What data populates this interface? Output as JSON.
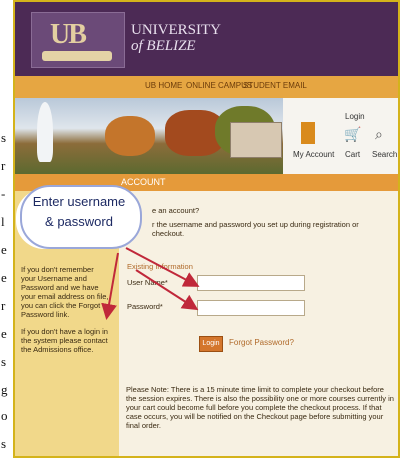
{
  "left_strip_letters": [
    "s",
    "r",
    "-",
    "l",
    "e",
    "e",
    "r",
    "e",
    "s",
    "g",
    "o",
    "s"
  ],
  "brand": {
    "logo_text": "UB",
    "university_line1": "UNIVERSITY",
    "university_line2": "of BELIZE"
  },
  "nav": {
    "items": [
      "UB HOME",
      "ONLINE CAMPUS",
      "STUDENT EMAIL"
    ]
  },
  "header_icons": {
    "login": "Login",
    "account": "My Account",
    "cart": "Cart",
    "search": "Search"
  },
  "section": {
    "title": "ACCOUNT"
  },
  "main": {
    "question": "e an account?",
    "instruction": "r the username and password you set up during registration or checkout.",
    "subheading": "Existing Information",
    "username_label": "User Name*",
    "password_label": "Password*",
    "login_button": "Login",
    "forgot_link": "Forgot Password?",
    "note": "Please Note: There is a 15 minute time limit to complete your checkout before the session expires. There is also the possibility one or more courses currently in your cart could become full before you complete the checkout process. If that case occurs, you will be notified on the Checkout page before submitting your final order."
  },
  "sidebar": {
    "help_text": "If you don't remember your Username and Password and we have your email address on file, you can click the Forgot Password link.",
    "no_login_text": "If you don't have a login in the system please contact the Admissions office."
  },
  "callout": {
    "line1": "Enter username",
    "line2": "& password"
  },
  "colors": {
    "header": "#4c2a55",
    "nav": "#e6a642",
    "sidebar": "#f1d88a",
    "frame_border": "#d4b31b",
    "arrow": "#c0283a",
    "callout_text": "#1d2a63"
  }
}
